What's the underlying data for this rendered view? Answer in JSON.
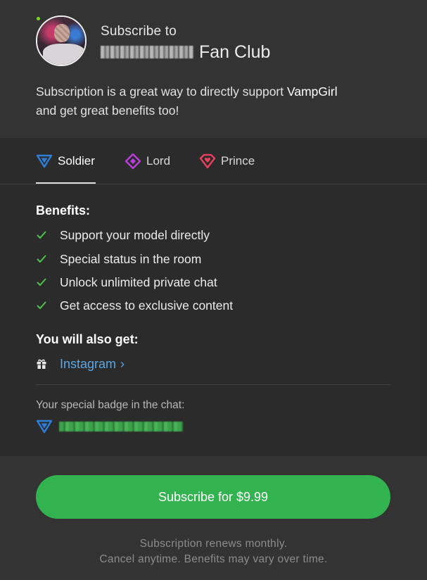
{
  "header": {
    "subscribe_to": "Subscribe to",
    "club_suffix": "Fan Club",
    "intro_prefix": "Subscription is a great way to directly support ",
    "model_name": "VampGirl",
    "intro_suffix": "and get great benefits too!"
  },
  "tabs": [
    {
      "label": "Soldier",
      "icon": "triangle-shield-icon",
      "color": "#2f7fd8",
      "active": true
    },
    {
      "label": "Lord",
      "icon": "diamond-icon",
      "color": "#b93fd9",
      "active": false
    },
    {
      "label": "Prince",
      "icon": "heart-gem-icon",
      "color": "#e8405e",
      "active": false
    }
  ],
  "benefits": {
    "title": "Benefits:",
    "items": [
      "Support your model directly",
      "Special status in the room",
      "Unlock unlimited private chat",
      "Get access to exclusive content"
    ]
  },
  "extras": {
    "title": "You will also get:",
    "instagram_label": "Instagram",
    "chevron": "›"
  },
  "badge": {
    "label": "Your special badge in the chat:"
  },
  "footer": {
    "button_label": "Subscribe for $9.99",
    "note_line1": "Subscription renews monthly.",
    "note_line2": "Cancel anytime. Benefits may vary over time."
  },
  "colors": {
    "accent_green": "#32b350",
    "check_green": "#4fc14c",
    "link_blue": "#5aa8e6",
    "online": "#7ed321"
  }
}
